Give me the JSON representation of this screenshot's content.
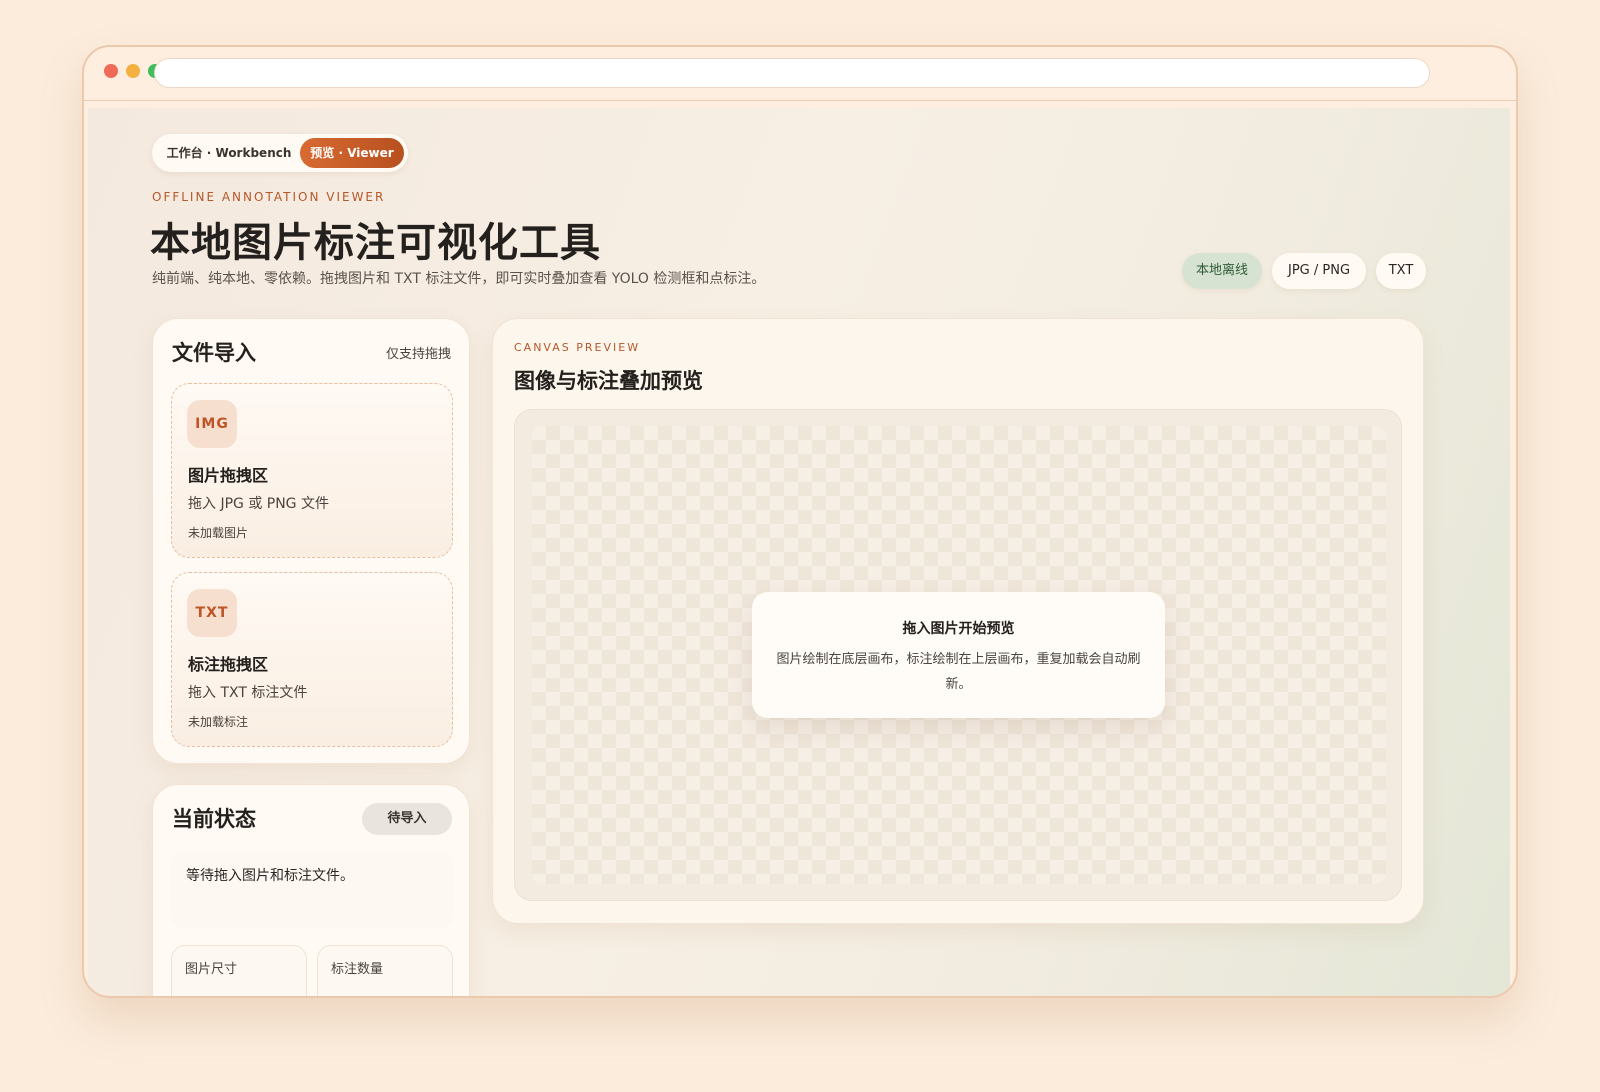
{
  "nav": {
    "workbench_label": "工作台 · Workbench",
    "viewer_label": "预览 · Viewer"
  },
  "header": {
    "eyebrow": "OFFLINE ANNOTATION VIEWER",
    "title": "本地图片标注可视化工具",
    "subtitle": "纯前端、纯本地、零依赖。拖拽图片和 TXT 标注文件，即可实时叠加查看 YOLO 检测框和点标注。",
    "chips": [
      "本地离线",
      "JPG / PNG",
      "TXT"
    ]
  },
  "import": {
    "title": "文件导入",
    "note": "仅支持拖拽",
    "image_drop": {
      "badge": "IMG",
      "title": "图片拖拽区",
      "desc": "拖入 JPG 或 PNG 文件",
      "state": "未加载图片"
    },
    "label_drop": {
      "badge": "TXT",
      "title": "标注拖拽区",
      "desc": "拖入 TXT 标注文件",
      "state": "未加载标注"
    }
  },
  "status": {
    "title": "当前状态",
    "badge": "待导入",
    "message": "等待拖入图片和标注文件。",
    "stats": [
      {
        "label": "图片尺寸"
      },
      {
        "label": "标注数量"
      }
    ]
  },
  "preview": {
    "eyebrow": "CANVAS PREVIEW",
    "title": "图像与标注叠加预览",
    "hint_title": "拖入图片开始预览",
    "hint_desc": "图片绘制在底层画布，标注绘制在上层画布，重复加载会自动刷新。"
  },
  "colors": {
    "accent": "#c85c28",
    "page_bg": "#fbecdc",
    "offline_chip": "#d6e3d2"
  }
}
